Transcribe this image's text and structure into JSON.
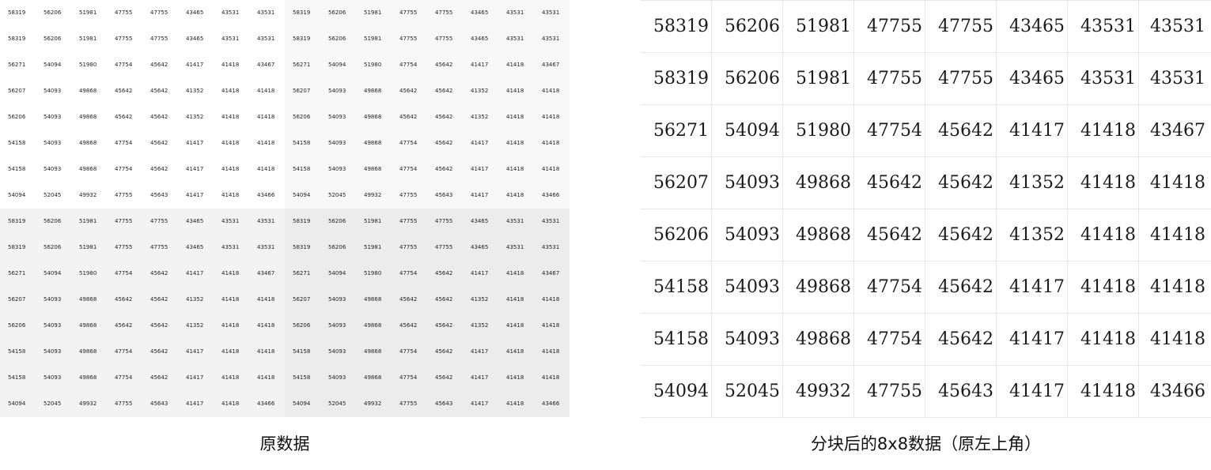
{
  "block": {
    "rows": [
      [
        "58319",
        "56206",
        "51981",
        "47755",
        "47755",
        "43465",
        "43531",
        "43531"
      ],
      [
        "58319",
        "56206",
        "51981",
        "47755",
        "47755",
        "43465",
        "43531",
        "43531"
      ],
      [
        "56271",
        "54094",
        "51980",
        "47754",
        "45642",
        "41417",
        "41418",
        "43467"
      ],
      [
        "56207",
        "54093",
        "49868",
        "45642",
        "45642",
        "41352",
        "41418",
        "41418"
      ],
      [
        "56206",
        "54093",
        "49868",
        "45642",
        "45642",
        "41352",
        "41418",
        "41418"
      ],
      [
        "54158",
        "54093",
        "49868",
        "47754",
        "45642",
        "41417",
        "41418",
        "41418"
      ],
      [
        "54158",
        "54093",
        "49868",
        "47754",
        "45642",
        "41417",
        "41418",
        "41418"
      ],
      [
        "54094",
        "52045",
        "49932",
        "47755",
        "45643",
        "41417",
        "41418",
        "43466"
      ]
    ]
  },
  "left_panel": {
    "caption": "原数据",
    "note_tiling": "16x16 view is the 8x8 block tiled 2x2"
  },
  "right_panel": {
    "caption": "分块后的8x8数据（原左上角）"
  },
  "colors": {
    "q0": "#ffffff",
    "q1": "#f8f8f8",
    "q2": "#f3f3f3",
    "q3": "#ececec",
    "grid_line": "#e6e6e6"
  }
}
